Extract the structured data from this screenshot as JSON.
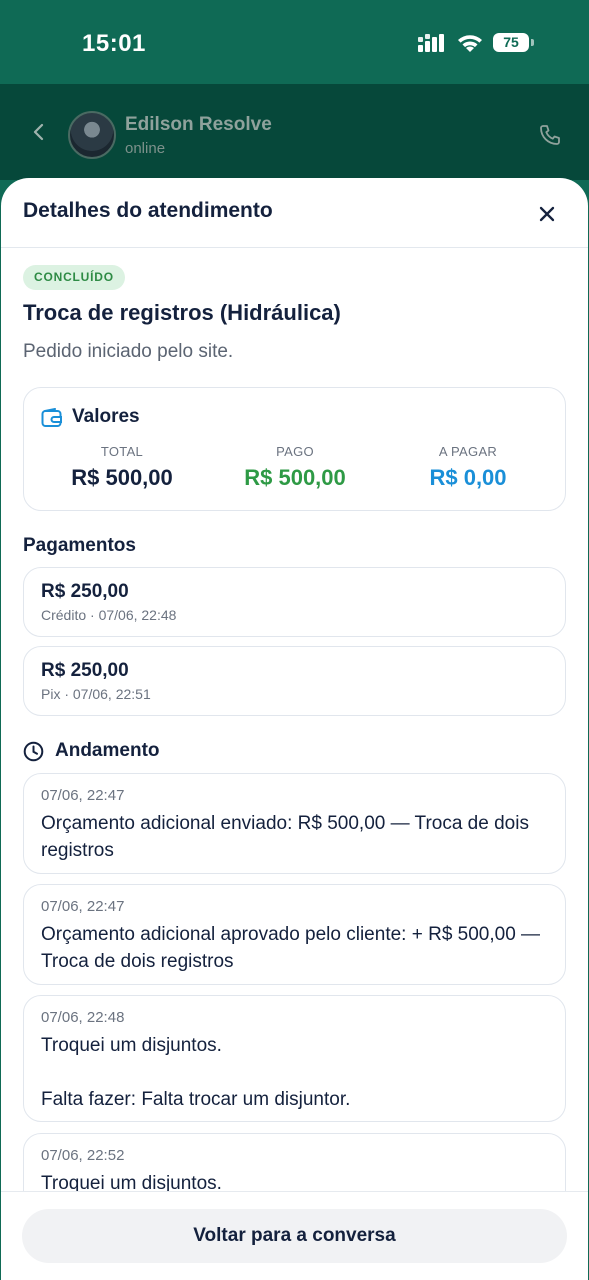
{
  "status_bar": {
    "time": "15:01",
    "battery": "75"
  },
  "chat_header": {
    "name": "Edilson Resolve",
    "status": "online"
  },
  "sheet": {
    "title": "Detalhes do atendimento",
    "badge": "CONCLUÍDO",
    "service_title": "Troca de registros (Hidráulica)",
    "description": "Pedido iniciado pelo site."
  },
  "values": {
    "title": "Valores",
    "total_label": "TOTAL",
    "total": "R$ 500,00",
    "paid_label": "PAGO",
    "paid": "R$ 500,00",
    "due_label": "A PAGAR",
    "due": "R$ 0,00"
  },
  "payments": {
    "title": "Pagamentos",
    "items": [
      {
        "amount": "R$ 250,00",
        "meta": "Crédito · 07/06, 22:48"
      },
      {
        "amount": "R$ 250,00",
        "meta": "Pix · 07/06, 22:51"
      }
    ]
  },
  "progress": {
    "title": "Andamento",
    "items": [
      {
        "date": "07/06, 22:47",
        "text": "Orçamento adicional enviado: R$ 500,00 — Troca de dois registros"
      },
      {
        "date": "07/06, 22:47",
        "text": "Orçamento adicional aprovado pelo cliente: + R$ 500,00 — Troca de dois registros"
      },
      {
        "date": "07/06, 22:48",
        "text": "Troquei um disjuntos.\n\nFalta fazer: Falta trocar um disjuntor."
      },
      {
        "date": "07/06, 22:52",
        "text": "Troquei um disjuntos."
      }
    ]
  },
  "footer": {
    "button": "Voltar para a conversa"
  },
  "colors": {
    "brand": "#0f6a55",
    "paid": "#2e9a45",
    "due": "#1a8fd8",
    "badge_bg": "#dcf2e2",
    "badge_fg": "#2e8b45"
  }
}
